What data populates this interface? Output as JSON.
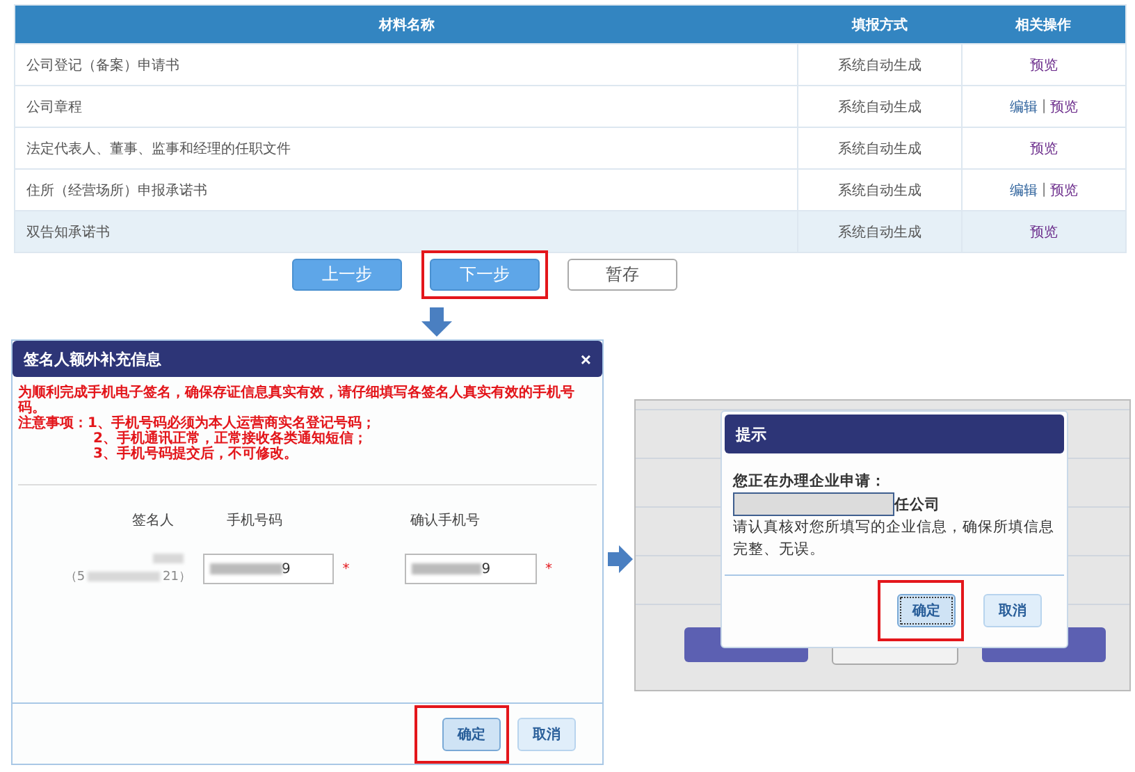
{
  "materials_table": {
    "columns": [
      "材料名称",
      "填报方式",
      "相关操作"
    ],
    "rows": [
      {
        "name": "公司登记（备案）申请书",
        "method": "系统自动生成",
        "actions": [
          "预览"
        ],
        "selected": false
      },
      {
        "name": "公司章程",
        "method": "系统自动生成",
        "actions": [
          "编辑",
          "预览"
        ],
        "separator": "|",
        "selected": false
      },
      {
        "name": "法定代表人、董事、监事和经理的任职文件",
        "method": "系统自动生成",
        "actions": [
          "预览"
        ],
        "selected": false
      },
      {
        "name": "住所（经营场所）申报承诺书",
        "method": "系统自动生成",
        "actions": [
          "编辑",
          "预览"
        ],
        "separator": "|",
        "selected": false
      },
      {
        "name": "双告知承诺书",
        "method": "系统自动生成",
        "actions": [
          "预览"
        ],
        "selected": true
      }
    ]
  },
  "step_buttons": [
    {
      "label": "上一步",
      "kind": "primary",
      "highlighted": false
    },
    {
      "label": "下一步",
      "kind": "primary",
      "highlighted": true
    },
    {
      "label": "暂存",
      "kind": "plain",
      "highlighted": false
    }
  ],
  "signer_dialog": {
    "title": "签名人额外补充信息",
    "close": "×",
    "notice": [
      "为顺利完成手机电子签名，确保存证信息真实有效，请仔细填写各签名人真实有效的手机号码。",
      "注意事项：1、手机号码必须为本人运营商实名登记号码；",
      "2、手机通讯正常，正常接收各类通知短信；",
      "3、手机号码提交后，不可修改。"
    ],
    "columns": [
      "签名人",
      "手机号码",
      "确认手机号"
    ],
    "signer_prefix": "（5",
    "signer_suffix": "21）",
    "phone": {
      "value": "9",
      "required": "*"
    },
    "confirm_phone": {
      "value": "9",
      "required": "*"
    },
    "buttons": [
      {
        "label": "确定",
        "highlighted": true
      },
      {
        "label": "取消",
        "highlighted": false
      }
    ]
  },
  "prompt_dialog": {
    "title": "提示",
    "heading": "您正在办理企业申请：",
    "company_suffix": "任公司",
    "message": "请认真核对您所填写的企业信息，确保所填信息完整、无误。",
    "buttons": [
      {
        "label": "确定",
        "highlighted": true
      },
      {
        "label": "取消",
        "highlighted": false
      }
    ]
  }
}
